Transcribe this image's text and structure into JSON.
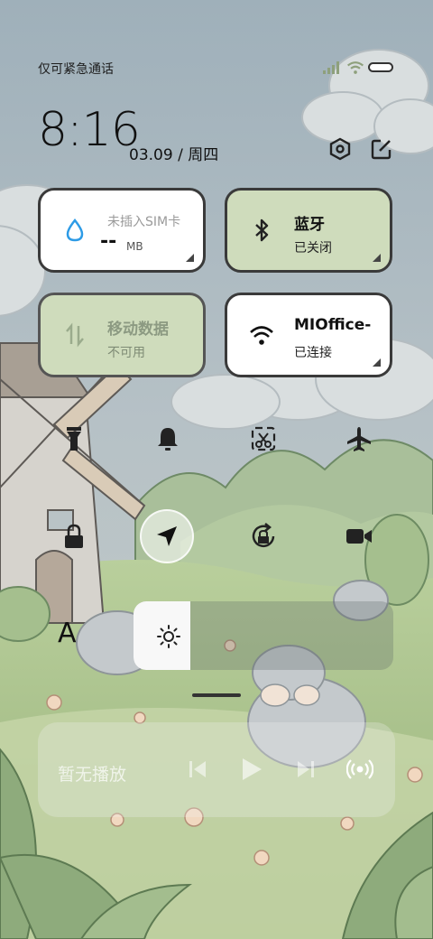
{
  "status_bar": {
    "carrier": "仅可紧急通话",
    "signal_icon": "signal-bars-icon",
    "wifi_icon": "wifi-icon",
    "battery_icon": "battery-icon"
  },
  "header": {
    "time": "8:16",
    "date": "03.09 / 周四",
    "settings_icon": "settings-hex-icon",
    "edit_icon": "edit-icon"
  },
  "tiles": {
    "data_usage": {
      "title": "未插入SIM卡",
      "value": "--",
      "unit": "MB",
      "icon": "water-drop-icon"
    },
    "bluetooth": {
      "title": "蓝牙",
      "status": "已关闭",
      "icon": "bluetooth-icon"
    },
    "mobile_data": {
      "title": "移动数据",
      "status": "不可用",
      "icon": "data-arrows-icon"
    },
    "wifi": {
      "title": "MIOffice-",
      "status": "已连接",
      "icon": "wifi-icon"
    }
  },
  "quick_toggles": [
    {
      "name": "flashlight",
      "icon": "flashlight-icon"
    },
    {
      "name": "bell",
      "icon": "bell-icon"
    },
    {
      "name": "screenshot",
      "icon": "scissors-icon"
    },
    {
      "name": "airplane",
      "icon": "airplane-icon"
    },
    {
      "name": "lock",
      "icon": "lock-icon"
    },
    {
      "name": "location",
      "icon": "navigation-arrow-icon"
    },
    {
      "name": "rotation-lock",
      "icon": "rotation-lock-icon"
    },
    {
      "name": "screen-record",
      "icon": "video-camera-icon"
    }
  ],
  "brightness": {
    "auto_label": "A",
    "level": 0.22,
    "icon": "sun-icon"
  },
  "media": {
    "label": "暂无播放",
    "prev_icon": "previous-icon",
    "play_icon": "play-icon",
    "next_icon": "next-icon",
    "cast_icon": "cast-icon"
  },
  "colors": {
    "sky": "#a2b3bd",
    "tile_green": "#cfdcbc",
    "tile_white": "#ffffff",
    "border": "#3a3a3a"
  }
}
